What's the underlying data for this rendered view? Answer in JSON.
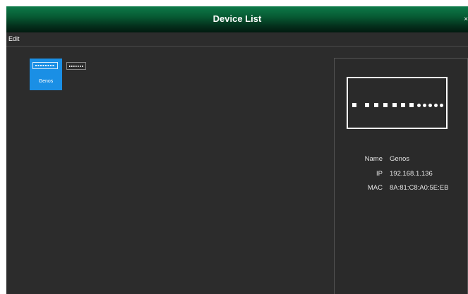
{
  "window": {
    "title": "Device List",
    "edge_glyph": "×"
  },
  "menu": {
    "edit": "Edit"
  },
  "devices": [
    {
      "name": "Genos",
      "selected": true
    },
    {
      "name": "",
      "selected": false
    }
  ],
  "details": {
    "name_label": "Name",
    "name_value": "Genos",
    "ip_label": "IP",
    "ip_value": "192.168.1.136",
    "mac_label": "MAC",
    "mac_value": "8A:81:C8:A0:5E:EB"
  },
  "colors": {
    "titlebar": "#0a6b3f",
    "background": "#2c2c2c",
    "selected_tile": "#1a8fe5",
    "panel": "#2a2a2a"
  }
}
